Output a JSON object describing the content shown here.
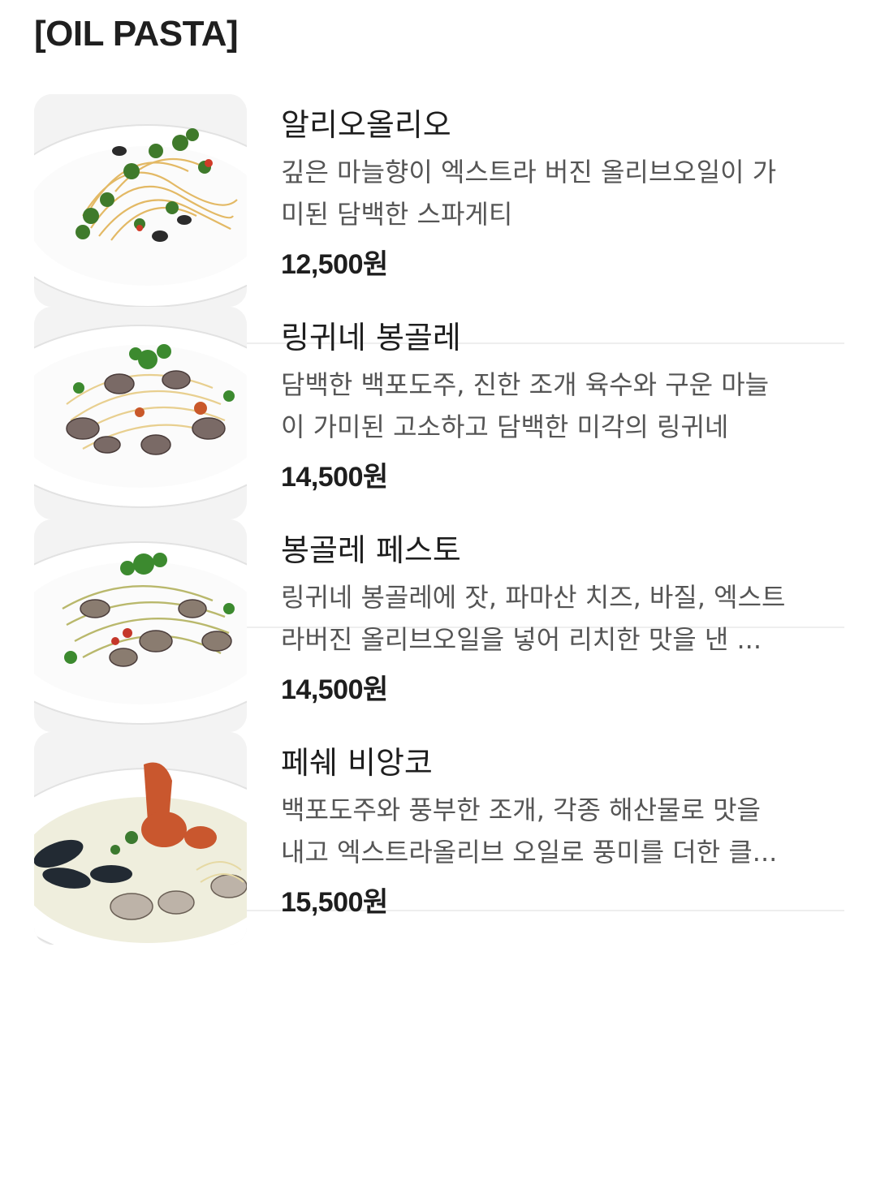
{
  "section": {
    "title": "[OIL PASTA]"
  },
  "items": [
    {
      "name": "알리오올리오",
      "desc_line1": "깊은 마늘향이 엑스트라 버진 올리브오일이 가",
      "desc_line2": "미된 담백한 스파게티",
      "price": "12,500원",
      "image": "aglio-olio-photo"
    },
    {
      "name": "링귀네 봉골레",
      "desc_line1": "담백한 백포도주, 진한 조개 육수와 구운 마늘",
      "desc_line2": "이 가미된 고소하고 담백한 미각의 링귀네",
      "price": "14,500원",
      "image": "vongole-photo"
    },
    {
      "name": "봉골레 페스토",
      "desc_line1": "링귀네 봉골레에 잣, 파마산 치즈, 바질, 엑스트",
      "desc_line2": "라버진 올리브오일을 넣어 리치한 맛을 낸 ...",
      "price": "14,500원",
      "image": "vongole-pesto-photo"
    },
    {
      "name": "페쉐 비앙코",
      "desc_line1": "백포도주와 풍부한 조개, 각종 해산물로 맛을",
      "desc_line2": "내고 엑스트라올리브 오일로 풍미를 더한 클...",
      "price": "15,500원",
      "image": "pesce-bianco-photo"
    }
  ]
}
